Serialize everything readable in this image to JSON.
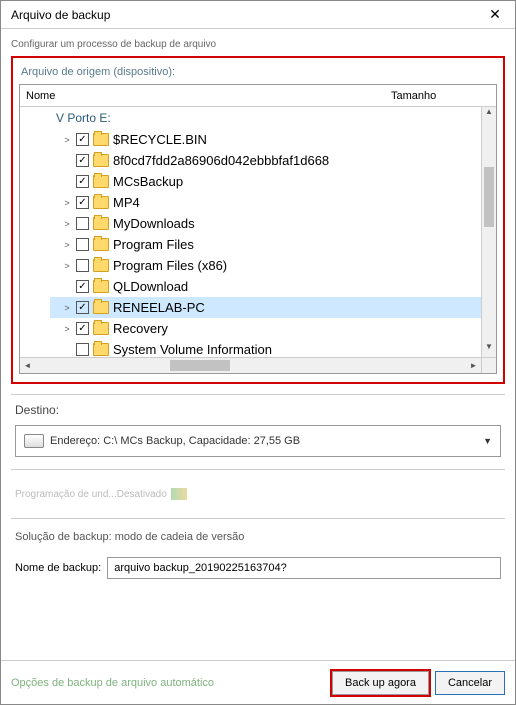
{
  "window": {
    "title": "Arquivo de backup"
  },
  "subtitle": "Configurar um processo de backup de arquivo",
  "source": {
    "frame_label": "Arquivo de origem (dispositivo):",
    "columns": {
      "name": "Nome",
      "size": "Tamanho"
    },
    "drive": "V Porto E:",
    "items": [
      {
        "label": "$RECYCLE.BIN",
        "checked": true,
        "expander": true
      },
      {
        "label": "8f0cd7fdd2a86906d042ebbbfaf1d668",
        "checked": true,
        "expander": false
      },
      {
        "label": "MCsBackup",
        "checked": true,
        "expander": false
      },
      {
        "label": "MP4",
        "checked": true,
        "expander": true
      },
      {
        "label": "MyDownloads",
        "checked": false,
        "expander": true
      },
      {
        "label": "Program Files",
        "checked": false,
        "expander": true
      },
      {
        "label": "Program Files (x86)",
        "checked": false,
        "expander": true
      },
      {
        "label": "QLDownload",
        "checked": true,
        "expander": false
      },
      {
        "label": "RENEELAB-PC",
        "checked": true,
        "expander": true,
        "selected": true
      },
      {
        "label": "Recovery",
        "checked": true,
        "expander": true
      },
      {
        "label": "System Volume Information",
        "checked": false,
        "expander": false
      }
    ]
  },
  "destination": {
    "label": "Destino:",
    "value": "Endereço: C:\\ MCs Backup, Capacidade: 27,55 GB"
  },
  "schedule": {
    "text": "Programação de und...Desativado"
  },
  "solution": {
    "label": "Solução de backup:",
    "value": "modo de cadeia de versão"
  },
  "backup_name": {
    "label": "Nome de backup:",
    "value": "arquivo backup_20190225163704?"
  },
  "footer": {
    "auto_link": "Opções de backup de arquivo automático",
    "primary": "Back up agora",
    "cancel": "Cancelar"
  }
}
